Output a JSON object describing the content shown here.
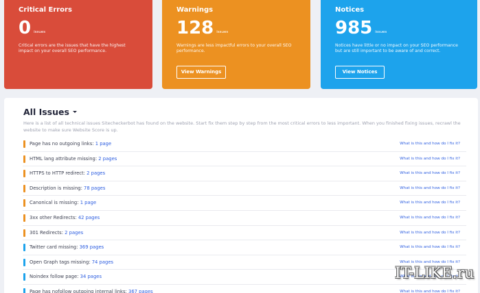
{
  "cards": {
    "critical": {
      "title": "Critical Errors",
      "count": "0",
      "count_label": "issues",
      "description": "Critical errors are the issues that have the highest impact on your overall SEO performance.",
      "color": "#d94c3a"
    },
    "warnings": {
      "title": "Warnings",
      "count": "128",
      "count_label": "issues",
      "description": "Warnings are less impactful errors to your overall SEO performance.",
      "button_label": "View Warnings",
      "color": "#ec9121"
    },
    "notices": {
      "title": "Notices",
      "count": "985",
      "count_label": "issues",
      "description": "Notices have little or no impact on your SEO performance but are still important to be aware of and correct.",
      "button_label": "View Notices",
      "color": "#1da3ec"
    }
  },
  "all_issues": {
    "title": "All Issues",
    "description": "Here is a list of all technical issues Sitecheckerbot has found on the website. Start fix them step by step from the most critical errors to less important. When you finished fixing issues, recrawl the website to make sure Website Score is up.",
    "help_link": "What is this and how do I fix it?",
    "items": [
      {
        "name": "Page has no outgoing links:",
        "count": "1 page",
        "severity": "warning"
      },
      {
        "name": "HTML lang attribute missing:",
        "count": "2 pages",
        "severity": "warning"
      },
      {
        "name": "HTTPS to HTTP redirect:",
        "count": "2 pages",
        "severity": "warning"
      },
      {
        "name": "Description is missing:",
        "count": "78 pages",
        "severity": "warning"
      },
      {
        "name": "Canonical is missing:",
        "count": "1 page",
        "severity": "warning"
      },
      {
        "name": "3xx other Redirects:",
        "count": "42 pages",
        "severity": "warning"
      },
      {
        "name": "301 Redirects:",
        "count": "2 pages",
        "severity": "warning"
      },
      {
        "name": "Twitter card missing:",
        "count": "369 pages",
        "severity": "notice"
      },
      {
        "name": "Open Graph tags missing:",
        "count": "74 pages",
        "severity": "notice"
      },
      {
        "name": "Noindex follow page:",
        "count": "34 pages",
        "severity": "notice"
      },
      {
        "name": "Page has nofollow outgoing internal links:",
        "count": "367 pages",
        "severity": "notice"
      }
    ]
  },
  "severity_colors": {
    "warning": "#ec9121",
    "notice": "#1da3ec"
  },
  "watermark": "IT-LIKE.ru"
}
